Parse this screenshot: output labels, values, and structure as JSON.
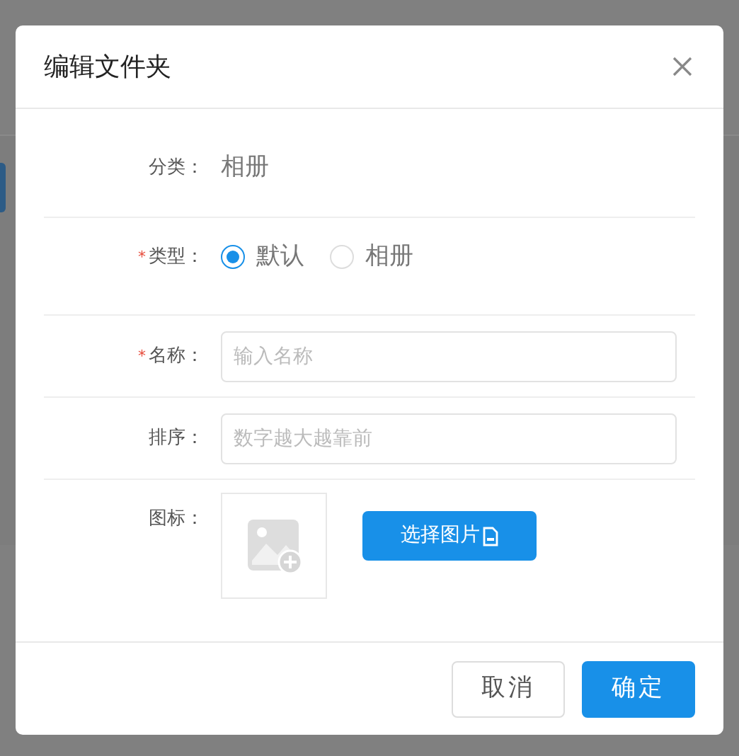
{
  "dialog": {
    "title": "编辑文件夹",
    "fields": [
      {
        "kind": "text",
        "label": "分类：",
        "value": "相册"
      },
      {
        "kind": "radio",
        "label": "类型：",
        "required_mark": "*",
        "options": [
          {
            "label": "默认",
            "selected": true
          },
          {
            "label": "相册",
            "selected": false
          }
        ]
      },
      {
        "kind": "input",
        "label": "名称：",
        "required_mark": "*",
        "placeholder": "输入名称"
      },
      {
        "kind": "input",
        "label": "排序：",
        "placeholder": "数字越大越靠前"
      },
      {
        "kind": "image",
        "label": "图标：",
        "button": "选择图片"
      }
    ],
    "footer_buttons": [
      {
        "label": "取消",
        "kind": "secondary"
      },
      {
        "label": "确定",
        "kind": "primary"
      }
    ]
  }
}
